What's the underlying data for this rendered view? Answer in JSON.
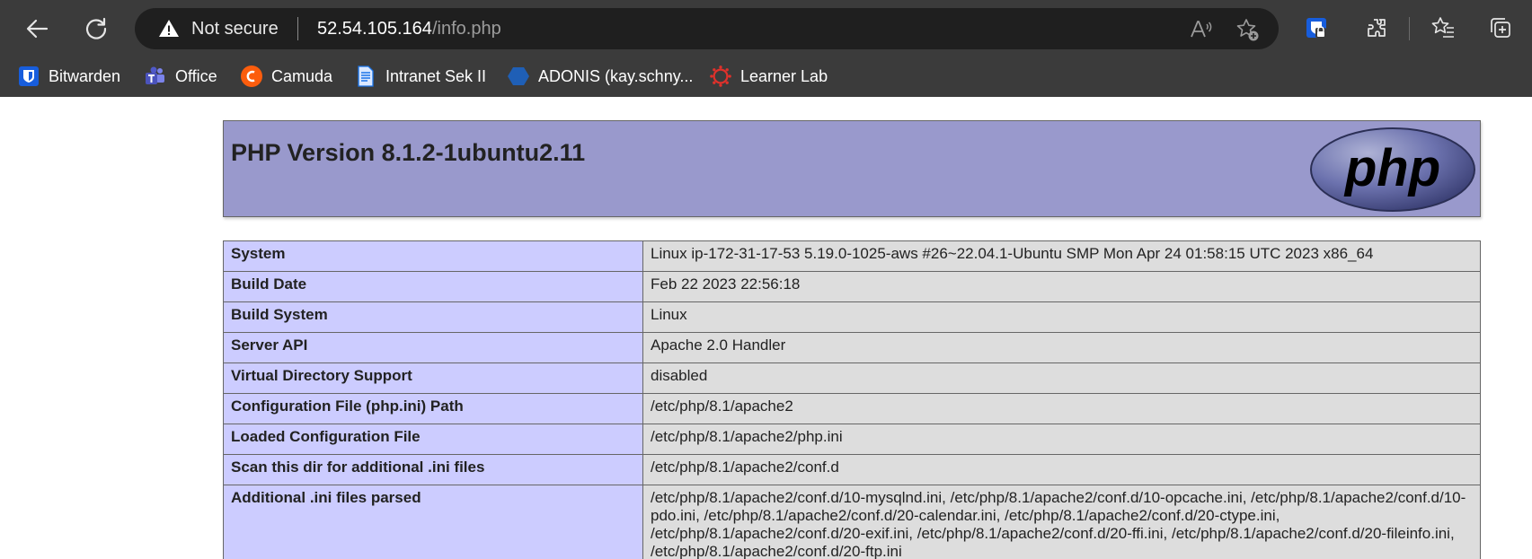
{
  "browser": {
    "nav": {
      "back_icon": "arrow-left-icon",
      "refresh_icon": "refresh-icon"
    },
    "address_bar": {
      "security_label": "Not secure",
      "host": "52.54.105.164",
      "path": "/info.php"
    },
    "address_icons": [
      "read-aloud-icon",
      "add-favorite-icon"
    ],
    "toolbar_icons": [
      "bitwarden-extension-icon",
      "extensions-icon",
      "favorites-icon",
      "collections-icon"
    ],
    "bookmarks": [
      {
        "label": "Bitwarden",
        "icon": "bitwarden-icon",
        "color": "#175ddc"
      },
      {
        "label": "Office",
        "icon": "teams-icon",
        "color": "#6264a7"
      },
      {
        "label": "Camuda",
        "icon": "camunda-icon",
        "color": "#fc5d0d"
      },
      {
        "label": "Intranet Sek II",
        "icon": "document-icon",
        "color": "#1a73e8"
      },
      {
        "label": "ADONIS (kay.schny...",
        "icon": "hexagon-icon",
        "color": "#1f5fb6"
      },
      {
        "label": "Learner Lab",
        "icon": "canvas-icon",
        "color": "#e0312b"
      }
    ]
  },
  "page": {
    "title": "PHP Version 8.1.2-1ubuntu2.11",
    "logo_icon": "php-logo-icon",
    "rows": [
      {
        "key": "System",
        "value": "Linux ip-172-31-17-53 5.19.0-1025-aws #26~22.04.1-Ubuntu SMP Mon Apr 24 01:58:15 UTC 2023 x86_64"
      },
      {
        "key": "Build Date",
        "value": "Feb 22 2023 22:56:18"
      },
      {
        "key": "Build System",
        "value": "Linux"
      },
      {
        "key": "Server API",
        "value": "Apache 2.0 Handler"
      },
      {
        "key": "Virtual Directory Support",
        "value": "disabled"
      },
      {
        "key": "Configuration File (php.ini) Path",
        "value": "/etc/php/8.1/apache2"
      },
      {
        "key": "Loaded Configuration File",
        "value": "/etc/php/8.1/apache2/php.ini"
      },
      {
        "key": "Scan this dir for additional .ini files",
        "value": "/etc/php/8.1/apache2/conf.d"
      },
      {
        "key": "Additional .ini files parsed",
        "value": "/etc/php/8.1/apache2/conf.d/10-mysqlnd.ini, /etc/php/8.1/apache2/conf.d/10-opcache.ini, /etc/php/8.1/apache2/conf.d/10-pdo.ini, /etc/php/8.1/apache2/conf.d/20-calendar.ini, /etc/php/8.1/apache2/conf.d/20-ctype.ini, /etc/php/8.1/apache2/conf.d/20-exif.ini, /etc/php/8.1/apache2/conf.d/20-ffi.ini, /etc/php/8.1/apache2/conf.d/20-fileinfo.ini, /etc/php/8.1/apache2/conf.d/20-ftp.ini"
      }
    ]
  },
  "colors": {
    "chrome_bg": "#3b3b3b",
    "header_bg": "#9999cc",
    "key_bg": "#ccccff",
    "value_bg": "#dddddd"
  }
}
